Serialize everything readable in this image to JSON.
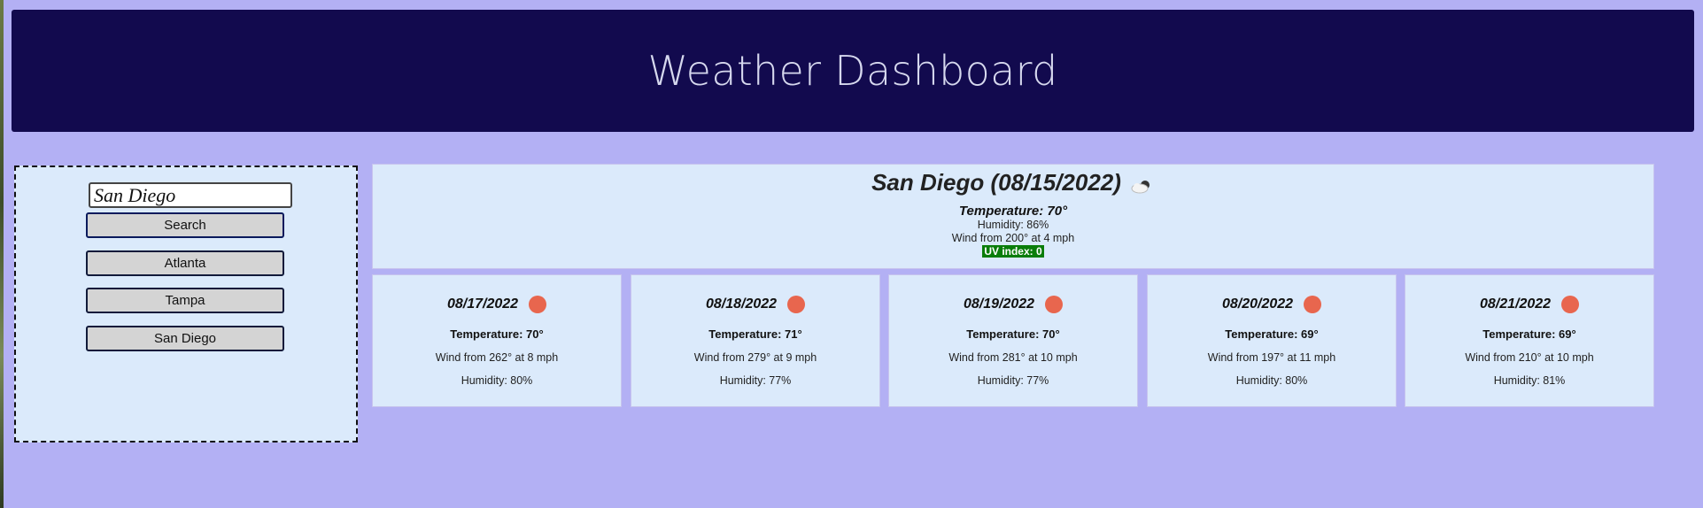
{
  "header": {
    "title": "Weather Dashboard"
  },
  "search": {
    "input_value": "San Diego",
    "button_label": "Search",
    "history": [
      "Atlanta",
      "Tampa",
      "San Diego"
    ]
  },
  "current": {
    "title": "San Diego (08/15/2022)",
    "icon": "partly-cloudy-icon",
    "temperature": "Temperature: 70°",
    "humidity": "Humidity: 86%",
    "wind": "Wind from 200° at 4 mph",
    "uv": "UV index: 0",
    "uv_color": "#0a7d0a"
  },
  "forecast": [
    {
      "date": "08/17/2022",
      "icon": "sun-icon",
      "temperature": "Temperature: 70°",
      "wind": "Wind from 262° at 8 mph",
      "humidity": "Humidity: 80%"
    },
    {
      "date": "08/18/2022",
      "icon": "sun-icon",
      "temperature": "Temperature: 71°",
      "wind": "Wind from 279° at 9 mph",
      "humidity": "Humidity: 77%"
    },
    {
      "date": "08/19/2022",
      "icon": "sun-icon",
      "temperature": "Temperature: 70°",
      "wind": "Wind from 281° at 10 mph",
      "humidity": "Humidity: 77%"
    },
    {
      "date": "08/20/2022",
      "icon": "sun-icon",
      "temperature": "Temperature: 69°",
      "wind": "Wind from 197° at 11 mph",
      "humidity": "Humidity: 80%"
    },
    {
      "date": "08/21/2022",
      "icon": "sun-icon",
      "temperature": "Temperature: 69°",
      "wind": "Wind from 210° at 10 mph",
      "humidity": "Humidity: 81%"
    }
  ],
  "colors": {
    "background": "#b3b0f4",
    "header": "#120a4e",
    "card": "#dbeafb",
    "sun": "#e8664e"
  }
}
